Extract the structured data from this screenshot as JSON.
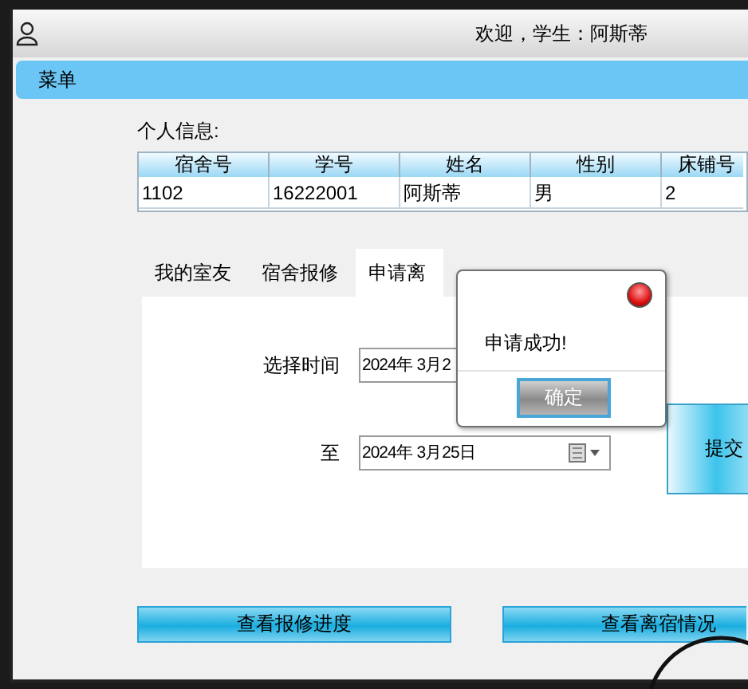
{
  "window": {
    "title": "欢迎，学生：阿斯蒂"
  },
  "menu_bar": {
    "label": "菜单"
  },
  "personal_info": {
    "label": "个人信息:",
    "table": {
      "columns": [
        "宿舍号",
        "学号",
        "姓名",
        "性别",
        "床铺号"
      ],
      "rows": [
        [
          "1102",
          "16222001",
          "阿斯蒂",
          "男",
          "2"
        ]
      ]
    }
  },
  "tabs": [
    {
      "label": "我的室友",
      "selected": false
    },
    {
      "label": "宿舍报修",
      "selected": false
    },
    {
      "label": "申请离",
      "selected": true
    }
  ],
  "form": {
    "start_label": "选择时间",
    "start_date": "2024年 3月2",
    "end_label": "至",
    "end_date": "2024年 3月25日",
    "submit": "提交"
  },
  "buttons": [
    "查看报修进度",
    "查看离宿情况"
  ],
  "dialog": {
    "message": "申请成功!",
    "ok": "确定"
  }
}
